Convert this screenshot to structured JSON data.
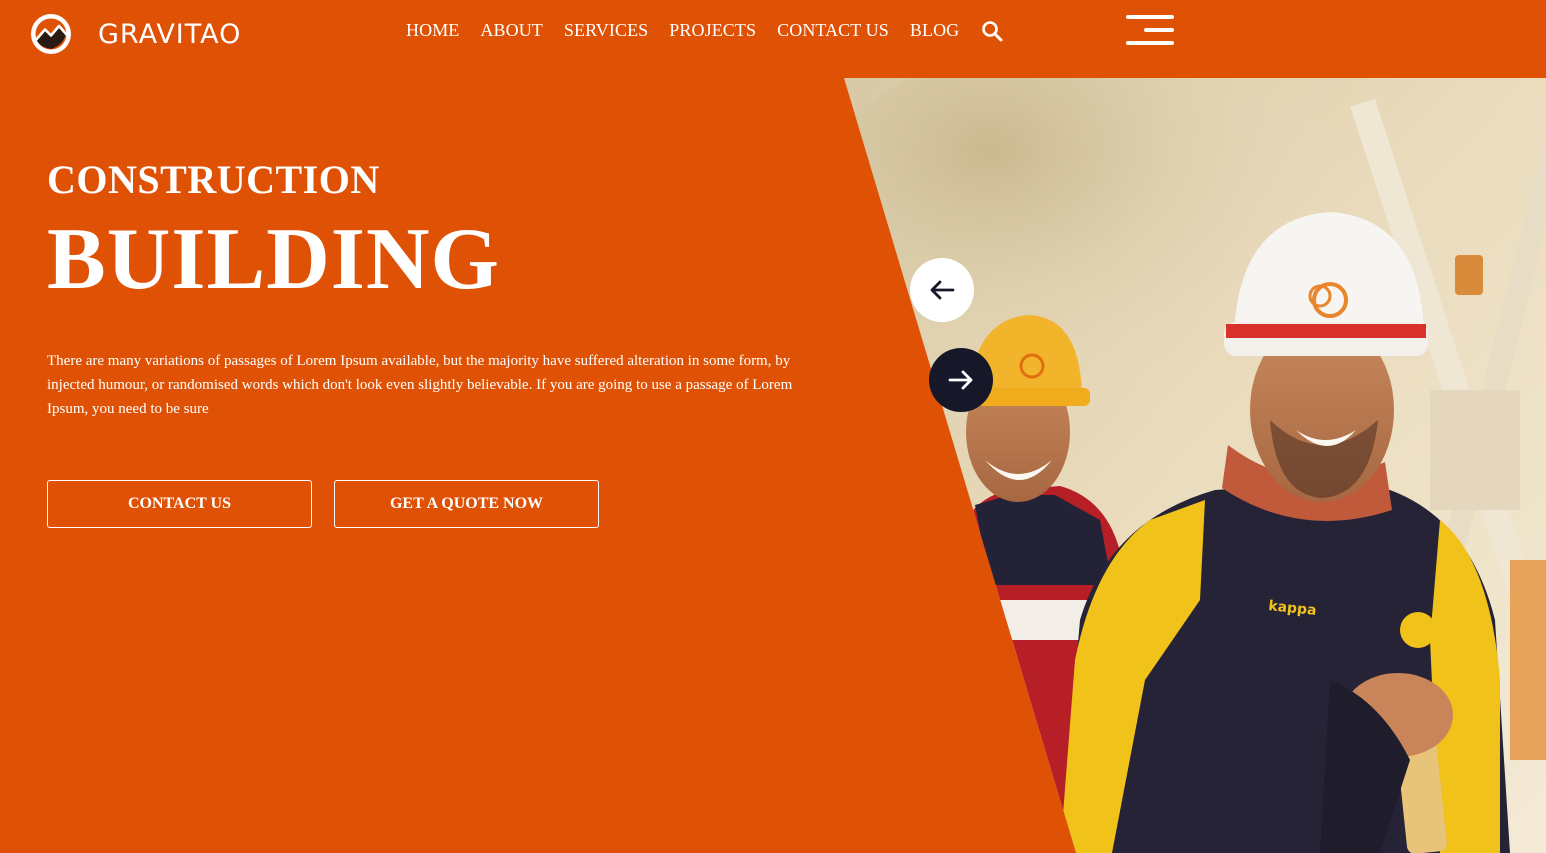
{
  "brand": {
    "name": "GRAVITAO",
    "logo_icon": "mountain-logo-icon"
  },
  "nav": {
    "items": [
      "HOME",
      "ABOUT",
      "SERVICES",
      "PROJECTS",
      "CONTACT US",
      "BLOG"
    ],
    "search_icon": "search-icon",
    "menu_icon": "hamburger-menu-icon"
  },
  "hero": {
    "kicker": "CONSTRUCTION",
    "title": "BUILDING",
    "description": "There are many variations of passages of Lorem Ipsum available, but the majority have suffered alteration in some form, by injected humour, or randomised words which don't look even slightly believable. If you are going to use a passage of Lorem Ipsum, you need to be sure",
    "buttons": {
      "contact": "CONTACT US",
      "quote": "GET A QUOTE NOW"
    }
  },
  "slider": {
    "prev_icon": "arrow-left-icon",
    "next_icon": "arrow-right-icon"
  },
  "colors": {
    "primary": "#df5205",
    "dark": "#17172a",
    "text": "#ffffff"
  }
}
